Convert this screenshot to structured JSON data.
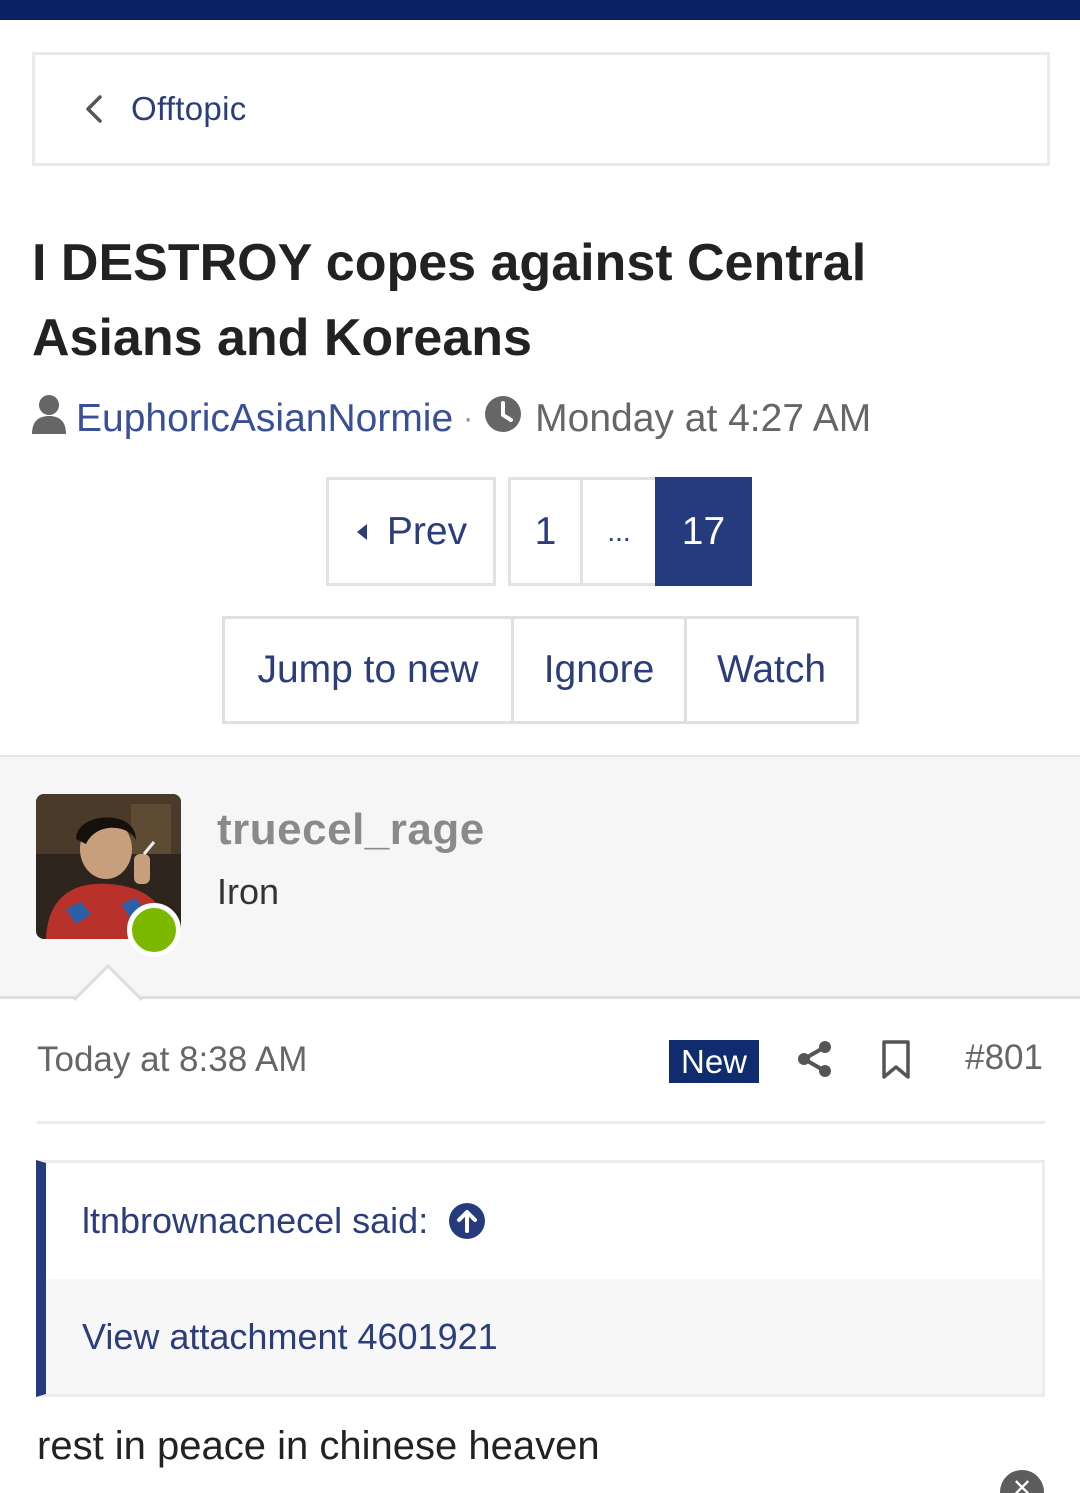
{
  "breadcrumb": {
    "label": "Offtopic"
  },
  "thread": {
    "title": "I DESTROY copes against Central Asians and Koreans",
    "author": "EuphoricAsianNormie",
    "separator": "·",
    "started": "Monday at 4:27 AM"
  },
  "pagination": {
    "prev_label": "Prev",
    "pages": [
      "1",
      "...",
      "17"
    ],
    "current": "17"
  },
  "actions": {
    "jump_label": "Jump to new",
    "ignore_label": "Ignore",
    "watch_label": "Watch"
  },
  "post": {
    "username": "truecel_rage",
    "rank": "Iron",
    "online": true,
    "date": "Today at 8:38 AM",
    "badge": "New",
    "number": "#801",
    "quote": {
      "attribution": "ltnbrownacnecel said:",
      "body": "View attachment 4601921"
    },
    "message": "rest in peace in chinese heaven"
  },
  "colors": {
    "header_bar": "#0b2262",
    "link": "#2b3d7a",
    "active_page": "#253b7e",
    "online": "#7db800"
  },
  "icons": {
    "back": "chevron-left-icon",
    "user": "user-icon",
    "clock": "clock-icon",
    "share": "share-icon",
    "bookmark": "bookmark-icon",
    "quote_jump": "arrow-up-circle-icon",
    "close": "close-icon"
  }
}
